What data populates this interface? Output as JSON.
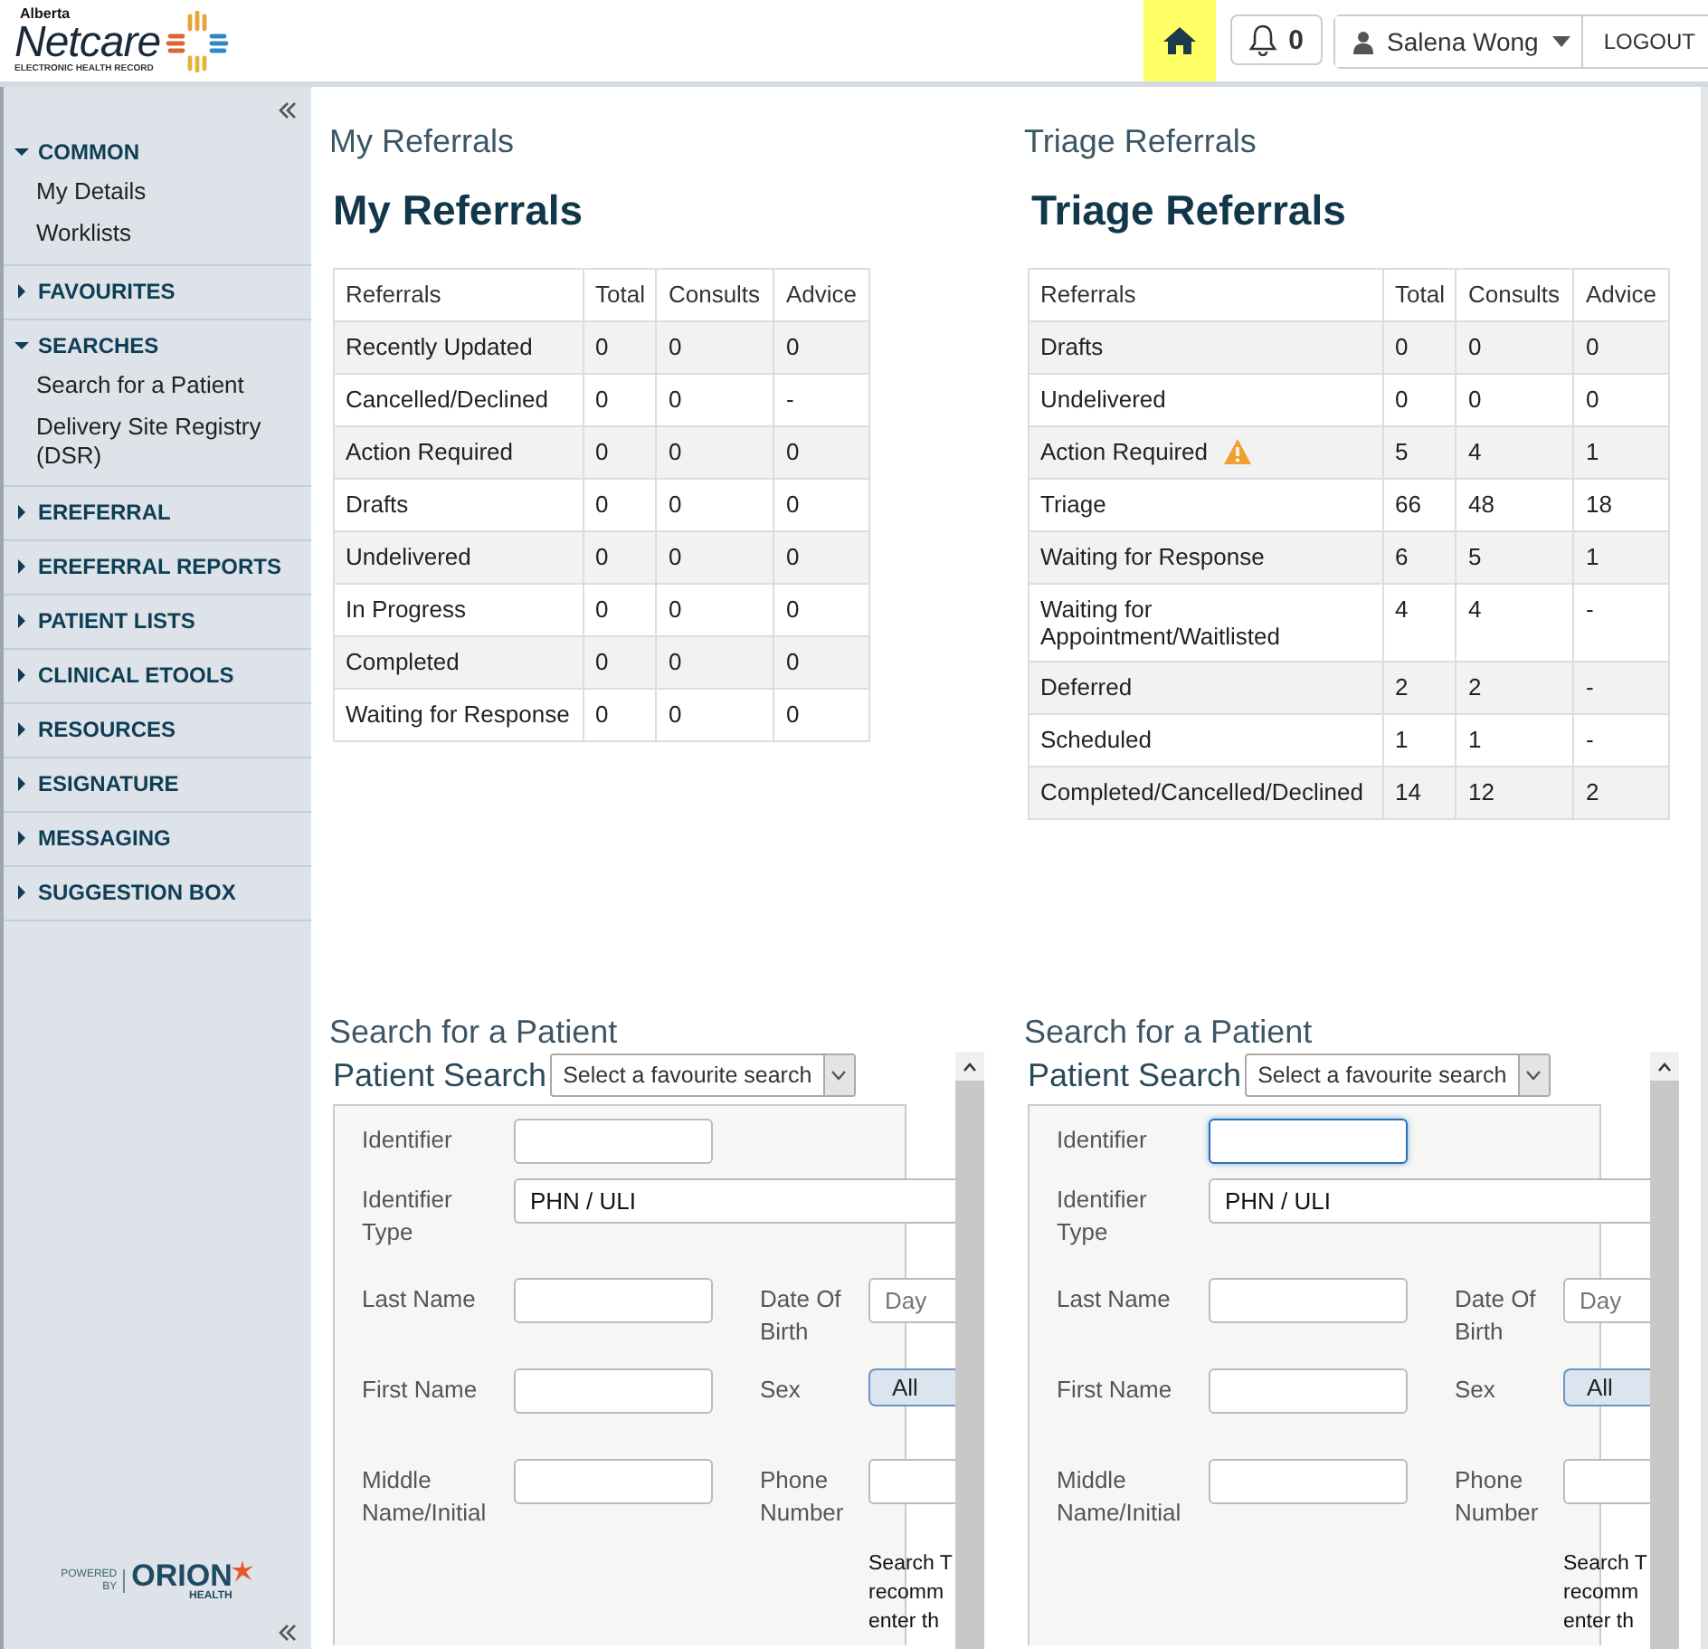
{
  "header": {
    "logo": {
      "region": "Alberta",
      "name": "Netcare",
      "tagline": "ELECTRONIC HEALTH RECORD"
    },
    "notifications": "0",
    "user": "Salena Wong",
    "logout": "LOGOUT"
  },
  "sidebar": {
    "sections": [
      {
        "label": "COMMON",
        "expanded": true,
        "items": [
          "My Details",
          "Worklists"
        ]
      },
      {
        "label": "FAVOURITES",
        "expanded": false
      },
      {
        "label": "SEARCHES",
        "expanded": true,
        "items": [
          "Search for a Patient",
          "Delivery Site Registry (DSR)"
        ]
      },
      {
        "label": "EREFERRAL",
        "expanded": false
      },
      {
        "label": "EREFERRAL REPORTS",
        "expanded": false
      },
      {
        "label": "PATIENT LISTS",
        "expanded": false
      },
      {
        "label": "CLINICAL ETOOLS",
        "expanded": false
      },
      {
        "label": "RESOURCES",
        "expanded": false
      },
      {
        "label": "ESIGNATURE",
        "expanded": false
      },
      {
        "label": "MESSAGING",
        "expanded": false
      },
      {
        "label": "SUGGESTION BOX",
        "expanded": false
      }
    ],
    "footer": {
      "powered": "POWERED",
      "by": "BY",
      "brand": "ORION",
      "brand_sub": "HEALTH"
    }
  },
  "referrals": [
    {
      "title": "My Referrals",
      "heading": "My Referrals",
      "columns": [
        "Referrals",
        "Total",
        "Consults",
        "Advice"
      ],
      "rows": [
        {
          "cells": [
            "Recently Updated",
            "0",
            "0",
            "0"
          ],
          "warning": false
        },
        {
          "cells": [
            "Cancelled/Declined",
            "0",
            "0",
            "-"
          ],
          "warning": false
        },
        {
          "cells": [
            "Action Required",
            "0",
            "0",
            "0"
          ],
          "warning": false
        },
        {
          "cells": [
            "Drafts",
            "0",
            "0",
            "0"
          ],
          "warning": false
        },
        {
          "cells": [
            "Undelivered",
            "0",
            "0",
            "0"
          ],
          "warning": false
        },
        {
          "cells": [
            "In Progress",
            "0",
            "0",
            "0"
          ],
          "warning": false
        },
        {
          "cells": [
            "Completed",
            "0",
            "0",
            "0"
          ],
          "warning": false
        },
        {
          "cells": [
            "Waiting for Response",
            "0",
            "0",
            "0"
          ],
          "warning": false
        }
      ]
    },
    {
      "title": "Triage Referrals",
      "heading": "Triage Referrals",
      "columns": [
        "Referrals",
        "Total",
        "Consults",
        "Advice"
      ],
      "rows": [
        {
          "cells": [
            "Drafts",
            "0",
            "0",
            "0"
          ],
          "warning": false
        },
        {
          "cells": [
            "Undelivered",
            "0",
            "0",
            "0"
          ],
          "warning": false
        },
        {
          "cells": [
            "Action Required",
            "5",
            "4",
            "1"
          ],
          "warning": true
        },
        {
          "cells": [
            "Triage",
            "66",
            "48",
            "18"
          ],
          "warning": false
        },
        {
          "cells": [
            "Waiting for Response",
            "6",
            "5",
            "1"
          ],
          "warning": false
        },
        {
          "cells": [
            "Waiting for Appointment/Waitlisted",
            "4",
            "4",
            "-"
          ],
          "warning": false
        },
        {
          "cells": [
            "Deferred",
            "2",
            "2",
            "-"
          ],
          "warning": false
        },
        {
          "cells": [
            "Scheduled",
            "1",
            "1",
            "-"
          ],
          "warning": false
        },
        {
          "cells": [
            "Completed/Cancelled/Declined",
            "14",
            "12",
            "2"
          ],
          "warning": false
        }
      ]
    }
  ],
  "searches": [
    {
      "title": "Search for a Patient",
      "subtitle": "Patient Search",
      "favourite_placeholder": "Select a favourite search",
      "form": {
        "identifier": {
          "label": "Identifier",
          "focused": false
        },
        "identifier_type": {
          "label": "Identifier Type",
          "value": "PHN / ULI"
        },
        "last_name": {
          "label": "Last Name"
        },
        "dob": {
          "label": "Date Of Birth",
          "placeholder": "Day"
        },
        "first_name": {
          "label": "First Name"
        },
        "sex": {
          "label": "Sex",
          "option": "All",
          "selected": true
        },
        "middle_name": {
          "label": "Middle Name/Initial"
        },
        "phone": {
          "label": "Phone Number"
        },
        "hint": [
          "Search T",
          "recomm",
          "enter th"
        ]
      }
    },
    {
      "title": "Search for a Patient",
      "subtitle": "Patient Search",
      "favourite_placeholder": "Select a favourite search",
      "form": {
        "identifier": {
          "label": "Identifier",
          "focused": true
        },
        "identifier_type": {
          "label": "Identifier Type",
          "value": "PHN / ULI"
        },
        "last_name": {
          "label": "Last Name"
        },
        "dob": {
          "label": "Date Of Birth",
          "placeholder": "Day"
        },
        "first_name": {
          "label": "First Name"
        },
        "sex": {
          "label": "Sex",
          "option": "All",
          "selected": true
        },
        "middle_name": {
          "label": "Middle Name/Initial"
        },
        "phone": {
          "label": "Phone Number"
        },
        "hint": [
          "Search T",
          "recomm",
          "enter th"
        ]
      }
    }
  ]
}
